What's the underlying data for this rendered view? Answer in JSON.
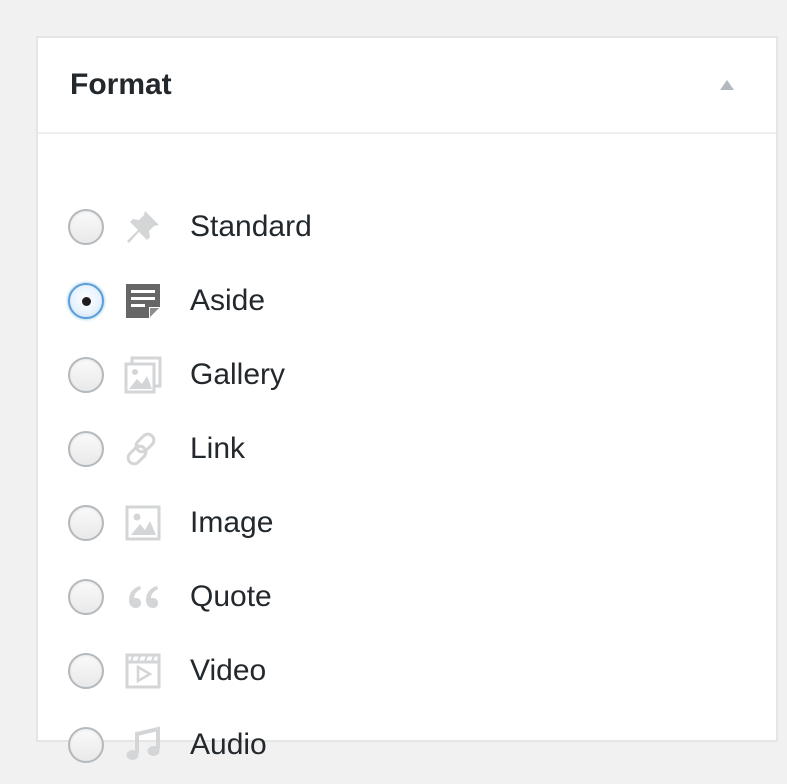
{
  "panel": {
    "title": "Format",
    "toggle_icon": "triangle-up-icon"
  },
  "colors": {
    "icon_muted": "#d3d5d7",
    "icon_active": "#666666",
    "radio_checked": "#5b9dd9"
  },
  "options": [
    {
      "label": "Standard",
      "icon": "pin-icon",
      "checked": false
    },
    {
      "label": "Aside",
      "icon": "aside-note-icon",
      "checked": true
    },
    {
      "label": "Gallery",
      "icon": "gallery-icon",
      "checked": false
    },
    {
      "label": "Link",
      "icon": "link-icon",
      "checked": false
    },
    {
      "label": "Image",
      "icon": "image-icon",
      "checked": false
    },
    {
      "label": "Quote",
      "icon": "quote-icon",
      "checked": false
    },
    {
      "label": "Video",
      "icon": "video-icon",
      "checked": false
    },
    {
      "label": "Audio",
      "icon": "audio-icon",
      "checked": false
    }
  ]
}
